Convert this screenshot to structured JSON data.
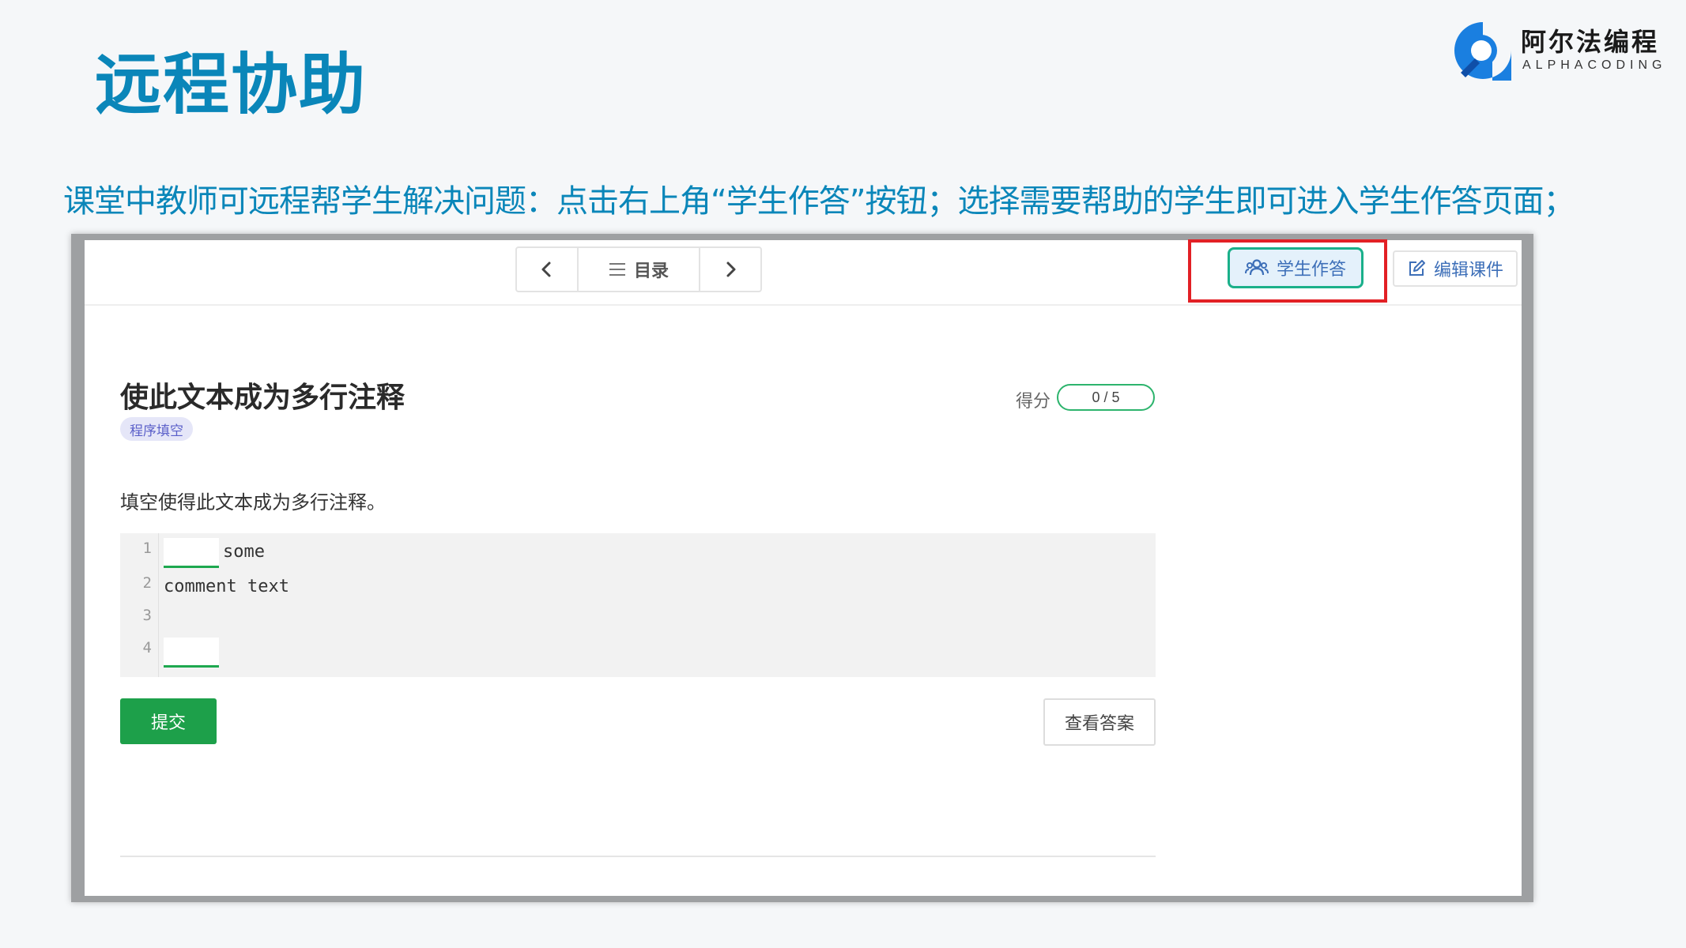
{
  "slide": {
    "title": "远程协助",
    "description": "课堂中教师可远程帮学生解决问题：点击右上角“学生作答”按钮；选择需要帮助的学生即可进入学生作答页面；"
  },
  "logo": {
    "name_cn": "阿尔法编程",
    "name_en": "ALPHACODING",
    "color": "#1a7fe0"
  },
  "toolbar": {
    "prev_icon": "chevron-left-icon",
    "toc_icon": "list-icon",
    "toc_label": "目录",
    "next_icon": "chevron-right-icon",
    "students_icon": "users-icon",
    "students_label": "学生作答",
    "edit_icon": "edit-icon",
    "edit_label": "编辑课件"
  },
  "question": {
    "title": "使此文本成为多行注释",
    "tag": "程序填空",
    "score_label": "得分",
    "score_value": "0 / 5",
    "prompt": "填空使得此文本成为多行注释。",
    "code_lines": [
      {
        "number": "1",
        "text": "some"
      },
      {
        "number": "2",
        "text": "comment text"
      },
      {
        "number": "3",
        "text": ""
      },
      {
        "number": "4",
        "text": ""
      }
    ],
    "submit_label": "提交",
    "answer_label": "查看答案"
  },
  "colors": {
    "title": "#0a86b9",
    "highlight": "#e22025",
    "submit": "#1da04a",
    "students_border": "#1ab08a"
  }
}
